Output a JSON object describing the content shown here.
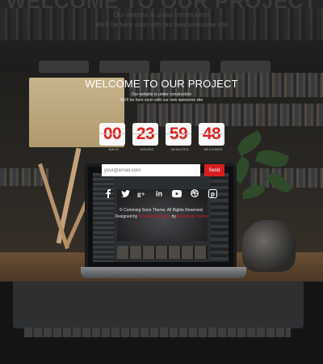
{
  "ghost": {
    "title": "WELCOME TO OUR PROJECT",
    "sub1": "Our website is under construction",
    "sub2": "We'll be here soon with our new awesome site"
  },
  "hero": {
    "title": "WELCOME TO OUR PROJECT",
    "subtitle1": "Our website is under construction",
    "subtitle2": "We'll be here soon with our new awesome site"
  },
  "countdown": [
    {
      "value": "00",
      "label": "DAYS"
    },
    {
      "value": "23",
      "label": "HOURS"
    },
    {
      "value": "59",
      "label": "MINUTES"
    },
    {
      "value": "48",
      "label": "SECONDS"
    }
  ],
  "subscribe": {
    "placeholder": "your@email.com",
    "button": "Send"
  },
  "social": [
    "facebook-icon",
    "twitter-icon",
    "google-plus-icon",
    "linkedin-icon",
    "youtube-icon",
    "dribbble-icon",
    "pinterest-icon"
  ],
  "footer": {
    "copyright": "© Comming Soon Theme. All Rights Reserved.",
    "designed_by": "Designed by",
    "designer": "Template Designs",
    "by": "by",
    "author": "Bootstrap Theme"
  },
  "colors": {
    "accent": "#d71f1f",
    "digit": "#e0201b",
    "text": "#ffffff"
  }
}
